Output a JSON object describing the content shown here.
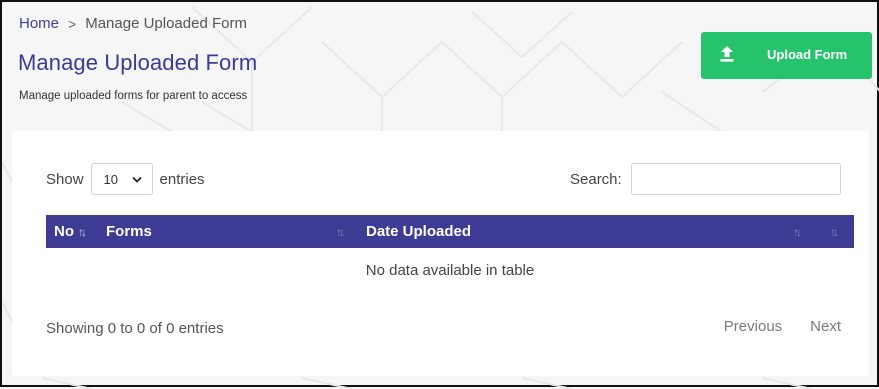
{
  "breadcrumb": {
    "home": "Home",
    "separator": ">",
    "current": "Manage Uploaded Form"
  },
  "header": {
    "title": "Manage Uploaded Form",
    "subtitle": "Manage uploaded forms for parent to access",
    "upload_button": {
      "label": "Upload Form",
      "icon": "upload-icon"
    }
  },
  "table_controls": {
    "show_label": "Show",
    "entries_value": "10",
    "entries_label": "entries",
    "search_label": "Search:",
    "search_value": ""
  },
  "table": {
    "columns": [
      "No",
      "Forms",
      "Date Uploaded"
    ],
    "empty_message": "No data available in table"
  },
  "footer": {
    "info": "Showing 0 to 0 of 0 entries",
    "previous": "Previous",
    "next": "Next"
  },
  "colors": {
    "primary": "#3d3b94",
    "success": "#27c26c",
    "title": "#3b3a98"
  }
}
